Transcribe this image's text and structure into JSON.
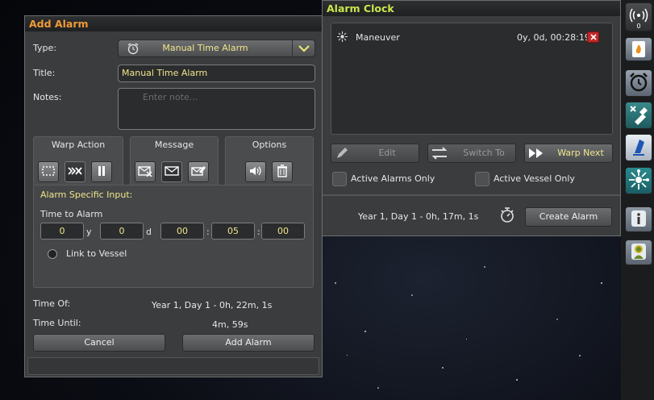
{
  "add_alarm": {
    "title": "Add Alarm",
    "title_color": "#f09a35",
    "type_label": "Type:",
    "type_value": "Manual Time Alarm",
    "title_label": "Title:",
    "title_value": "Manual Time Alarm",
    "notes_label": "Notes:",
    "notes_placeholder": "Enter note...",
    "warp_action_label": "Warp Action",
    "message_label": "Message",
    "options_label": "Options",
    "specific_heading": "Alarm Specific Input:",
    "time_to_alarm_label": "Time to Alarm",
    "years": "0",
    "years_unit": "y",
    "days": "0",
    "days_unit": "d",
    "hours": "00",
    "minutes": "05",
    "seconds": "00",
    "sep": ":",
    "link_vessel": "Link to Vessel",
    "time_of_label": "Time Of:",
    "time_of_value": "Year 1, Day 1 - 0h, 22m, 1s",
    "time_until_label": "Time Until:",
    "time_until_value": "4m, 59s",
    "cancel": "Cancel",
    "add": "Add Alarm"
  },
  "alarm_clock": {
    "title": "Alarm Clock",
    "title_color": "#c8e84a",
    "alarms": [
      {
        "icon": "maneuver-node-icon",
        "name": "Maneuver",
        "time": "0y, 0d, 00:28:19"
      }
    ],
    "edit": "Edit",
    "switch_to": "Switch To",
    "warp_next": "Warp Next",
    "active_alarms_only": "Active Alarms Only",
    "active_vessel_only": "Active Vessel Only",
    "current_time": "Year 1, Day 1 - 0h, 17m, 1s",
    "create_alarm": "Create Alarm"
  },
  "toolbar": {
    "commnet_count": "0",
    "buttons": [
      "commnet-signal-icon",
      "resources-fuel-icon",
      "alarm-clock-icon",
      "engineer-tools-icon",
      "kerbnet-icon",
      "maneuver-node-icon",
      "info-icon",
      "kerbal-portrait-icon"
    ]
  }
}
